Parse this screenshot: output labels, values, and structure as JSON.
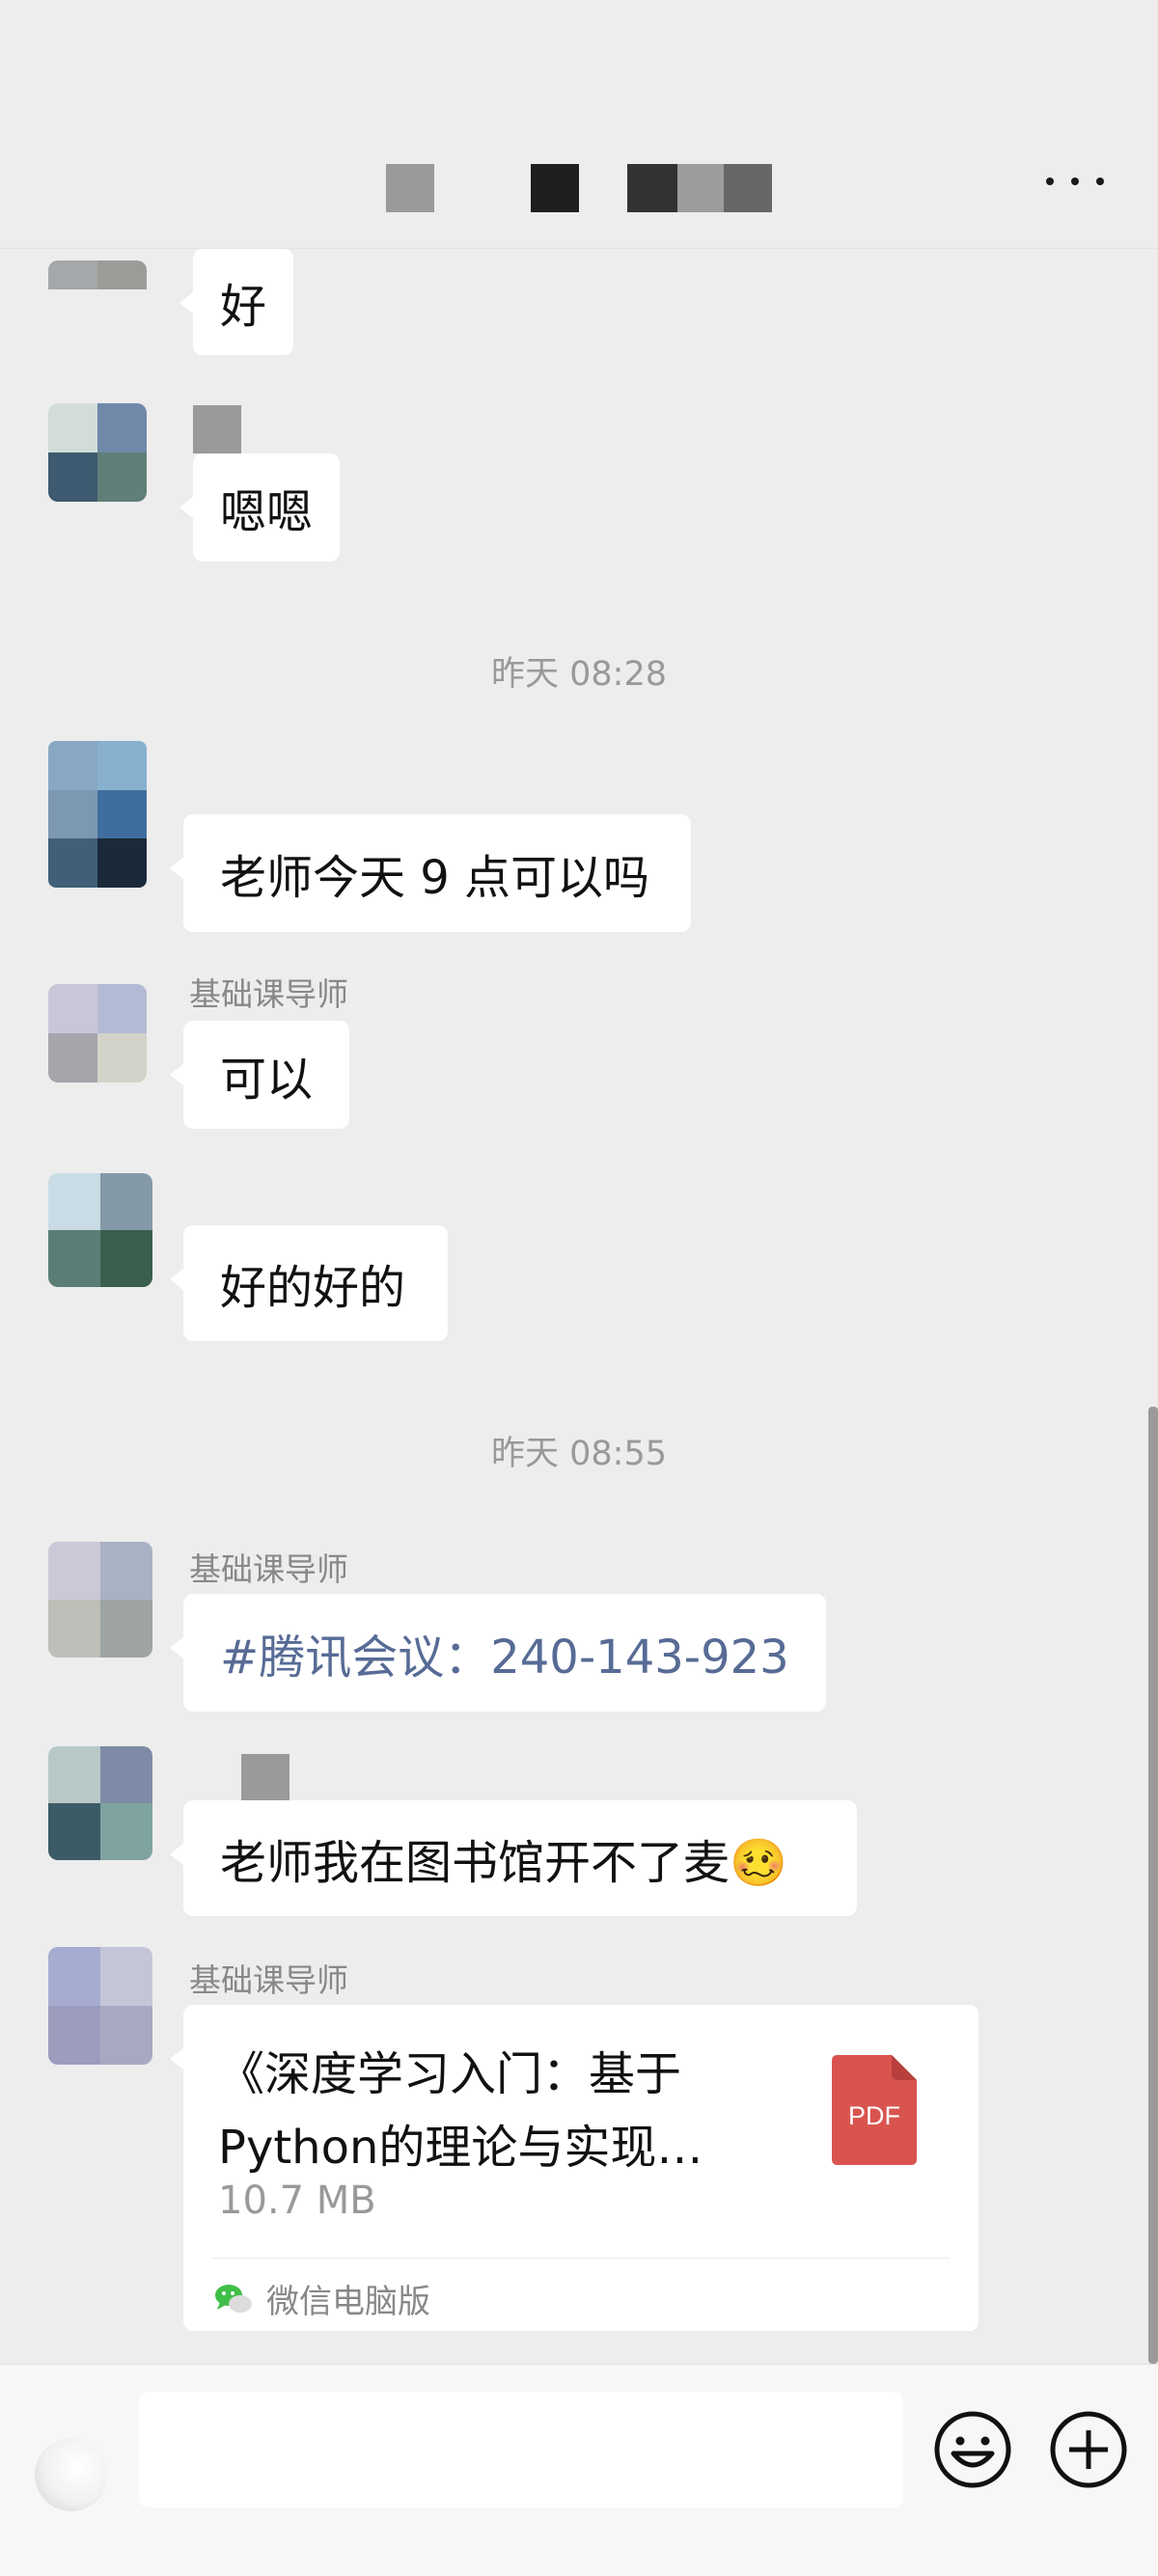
{
  "header": {
    "more_icon": "more-icon",
    "title_blocks": [
      "#9a9a9a",
      "#1e1e1e",
      "#323232",
      "#9c9c9c",
      "#666666"
    ]
  },
  "messages": [
    {
      "id": "m1",
      "sender": "",
      "text": "好",
      "avatar_colors": [
        "#a4a8aa",
        "#9b9c98",
        "#ededed",
        "#ededed"
      ]
    },
    {
      "id": "m2",
      "sender": "",
      "text": "嗯嗯",
      "avatar_colors": [
        "#d2ddd9",
        "#7089a8",
        "#3e5a70",
        "#5f7f78"
      ]
    },
    {
      "id": "t1",
      "time": "昨天 08:28"
    },
    {
      "id": "m3",
      "sender": "",
      "text": "老师今天 9 点可以吗",
      "avatar_colors": [
        "#87a7c3",
        "#87b1cf",
        "#415f78",
        "#1b2a3a"
      ]
    },
    {
      "id": "m4",
      "sender": "基础课导师",
      "text": "可以",
      "avatar_colors": [
        "#c8c7d8",
        "#b2bbd3",
        "#a5a5ac",
        "#d4d3ca"
      ]
    },
    {
      "id": "m5",
      "sender": "",
      "text": "好的好的",
      "avatar_colors": [
        "#c9dbe5",
        "#8399a8",
        "#5a7e75",
        "#3a5f4c"
      ]
    },
    {
      "id": "t2",
      "time": "昨天 08:55"
    },
    {
      "id": "m6",
      "sender": "基础课导师",
      "text": "#腾讯会议：240-143-923",
      "avatar_colors": [
        "#cbc9d8",
        "#a9b2c4",
        "#bebfb8",
        "#9ea4a1"
      ]
    },
    {
      "id": "m7",
      "sender": "",
      "text": "老师我在图书馆开不了麦🥴",
      "avatar_colors": [
        "#b8c8c8",
        "#7d8ba6",
        "#3b5c66",
        "#7fa3a0"
      ]
    },
    {
      "id": "m8",
      "sender": "基础课导师",
      "avatar_colors": [
        "#a6acd0",
        "#c4c6d8",
        "#9c9dbd",
        "#a7a9c3"
      ]
    }
  ],
  "file_message": {
    "name_line1": "《深度学习入门：基于",
    "name_line2": "Python的理论与实现…",
    "size": "10.7 MB",
    "type_label": "PDF",
    "source": "微信电脑版",
    "pdf_color": "#d9544f"
  },
  "input_bar": {
    "text_value": "",
    "voice_icon": "voice-icon",
    "emoji_icon": "emoji-icon",
    "plus_icon": "plus-icon"
  }
}
